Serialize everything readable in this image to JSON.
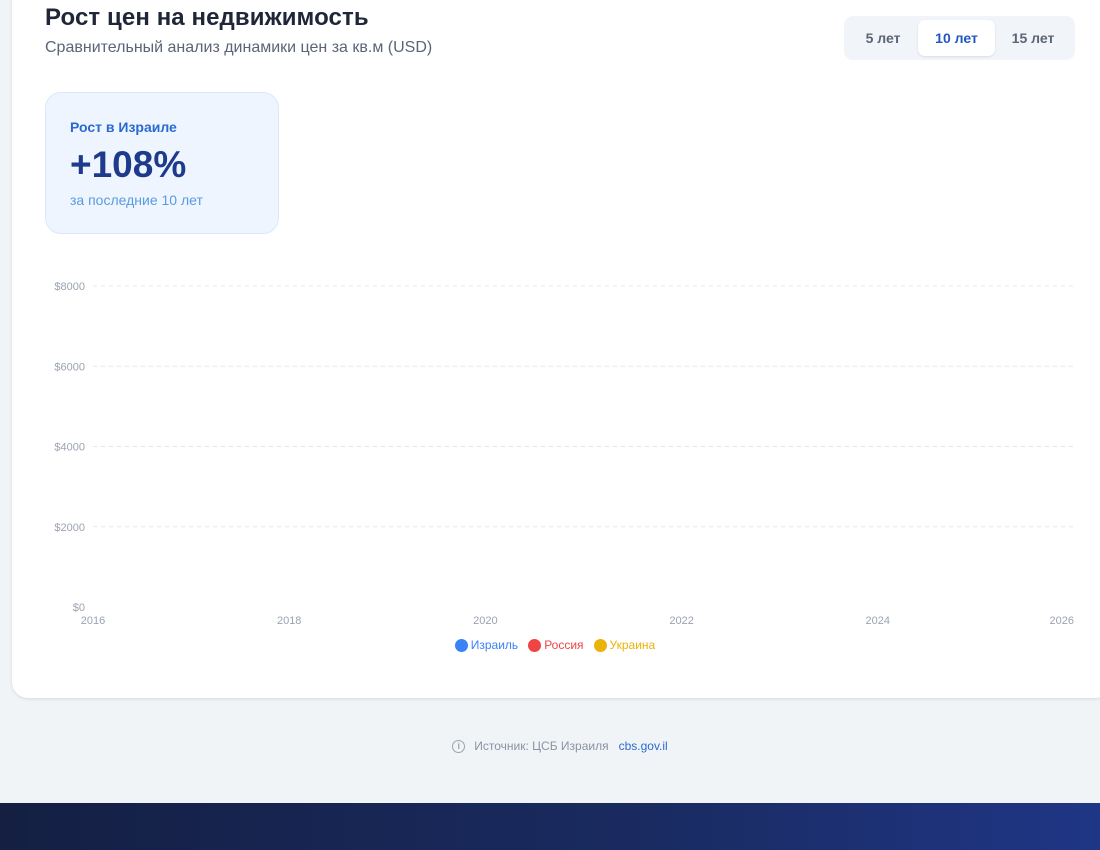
{
  "header": {
    "title": "Рост цен на недвижимость",
    "subtitle": "Сравнительный анализ динамики цен за кв.м (USD)"
  },
  "period_tabs": [
    {
      "label": "5 лет",
      "active": false
    },
    {
      "label": "10 лет",
      "active": true
    },
    {
      "label": "15 лет",
      "active": false
    }
  ],
  "stat": {
    "label": "Рост в Израиле",
    "value": "+108%",
    "period": "за последние 10 лет"
  },
  "chart_data": {
    "type": "line",
    "x_ticks": [
      "2016",
      "2018",
      "2020",
      "2022",
      "2024",
      "2026"
    ],
    "y_ticks": [
      "$0",
      "$2000",
      "$4000",
      "$6000",
      "$8000"
    ],
    "xlim": [
      2016,
      2026
    ],
    "ylim": [
      0,
      8000
    ],
    "grid": true,
    "series": [
      {
        "name": "Израиль",
        "color": "#3b82f6",
        "values": []
      },
      {
        "name": "Россия",
        "color": "#ef4444",
        "values": []
      },
      {
        "name": "Украина",
        "color": "#eab308",
        "values": []
      }
    ],
    "legend_position": "bottom"
  },
  "source": {
    "text": "Источник: ЦСБ Израиля",
    "link_text": "cbs.gov.il"
  },
  "colors": {
    "accent": "#2456c2",
    "footer": "#1a2b62"
  }
}
